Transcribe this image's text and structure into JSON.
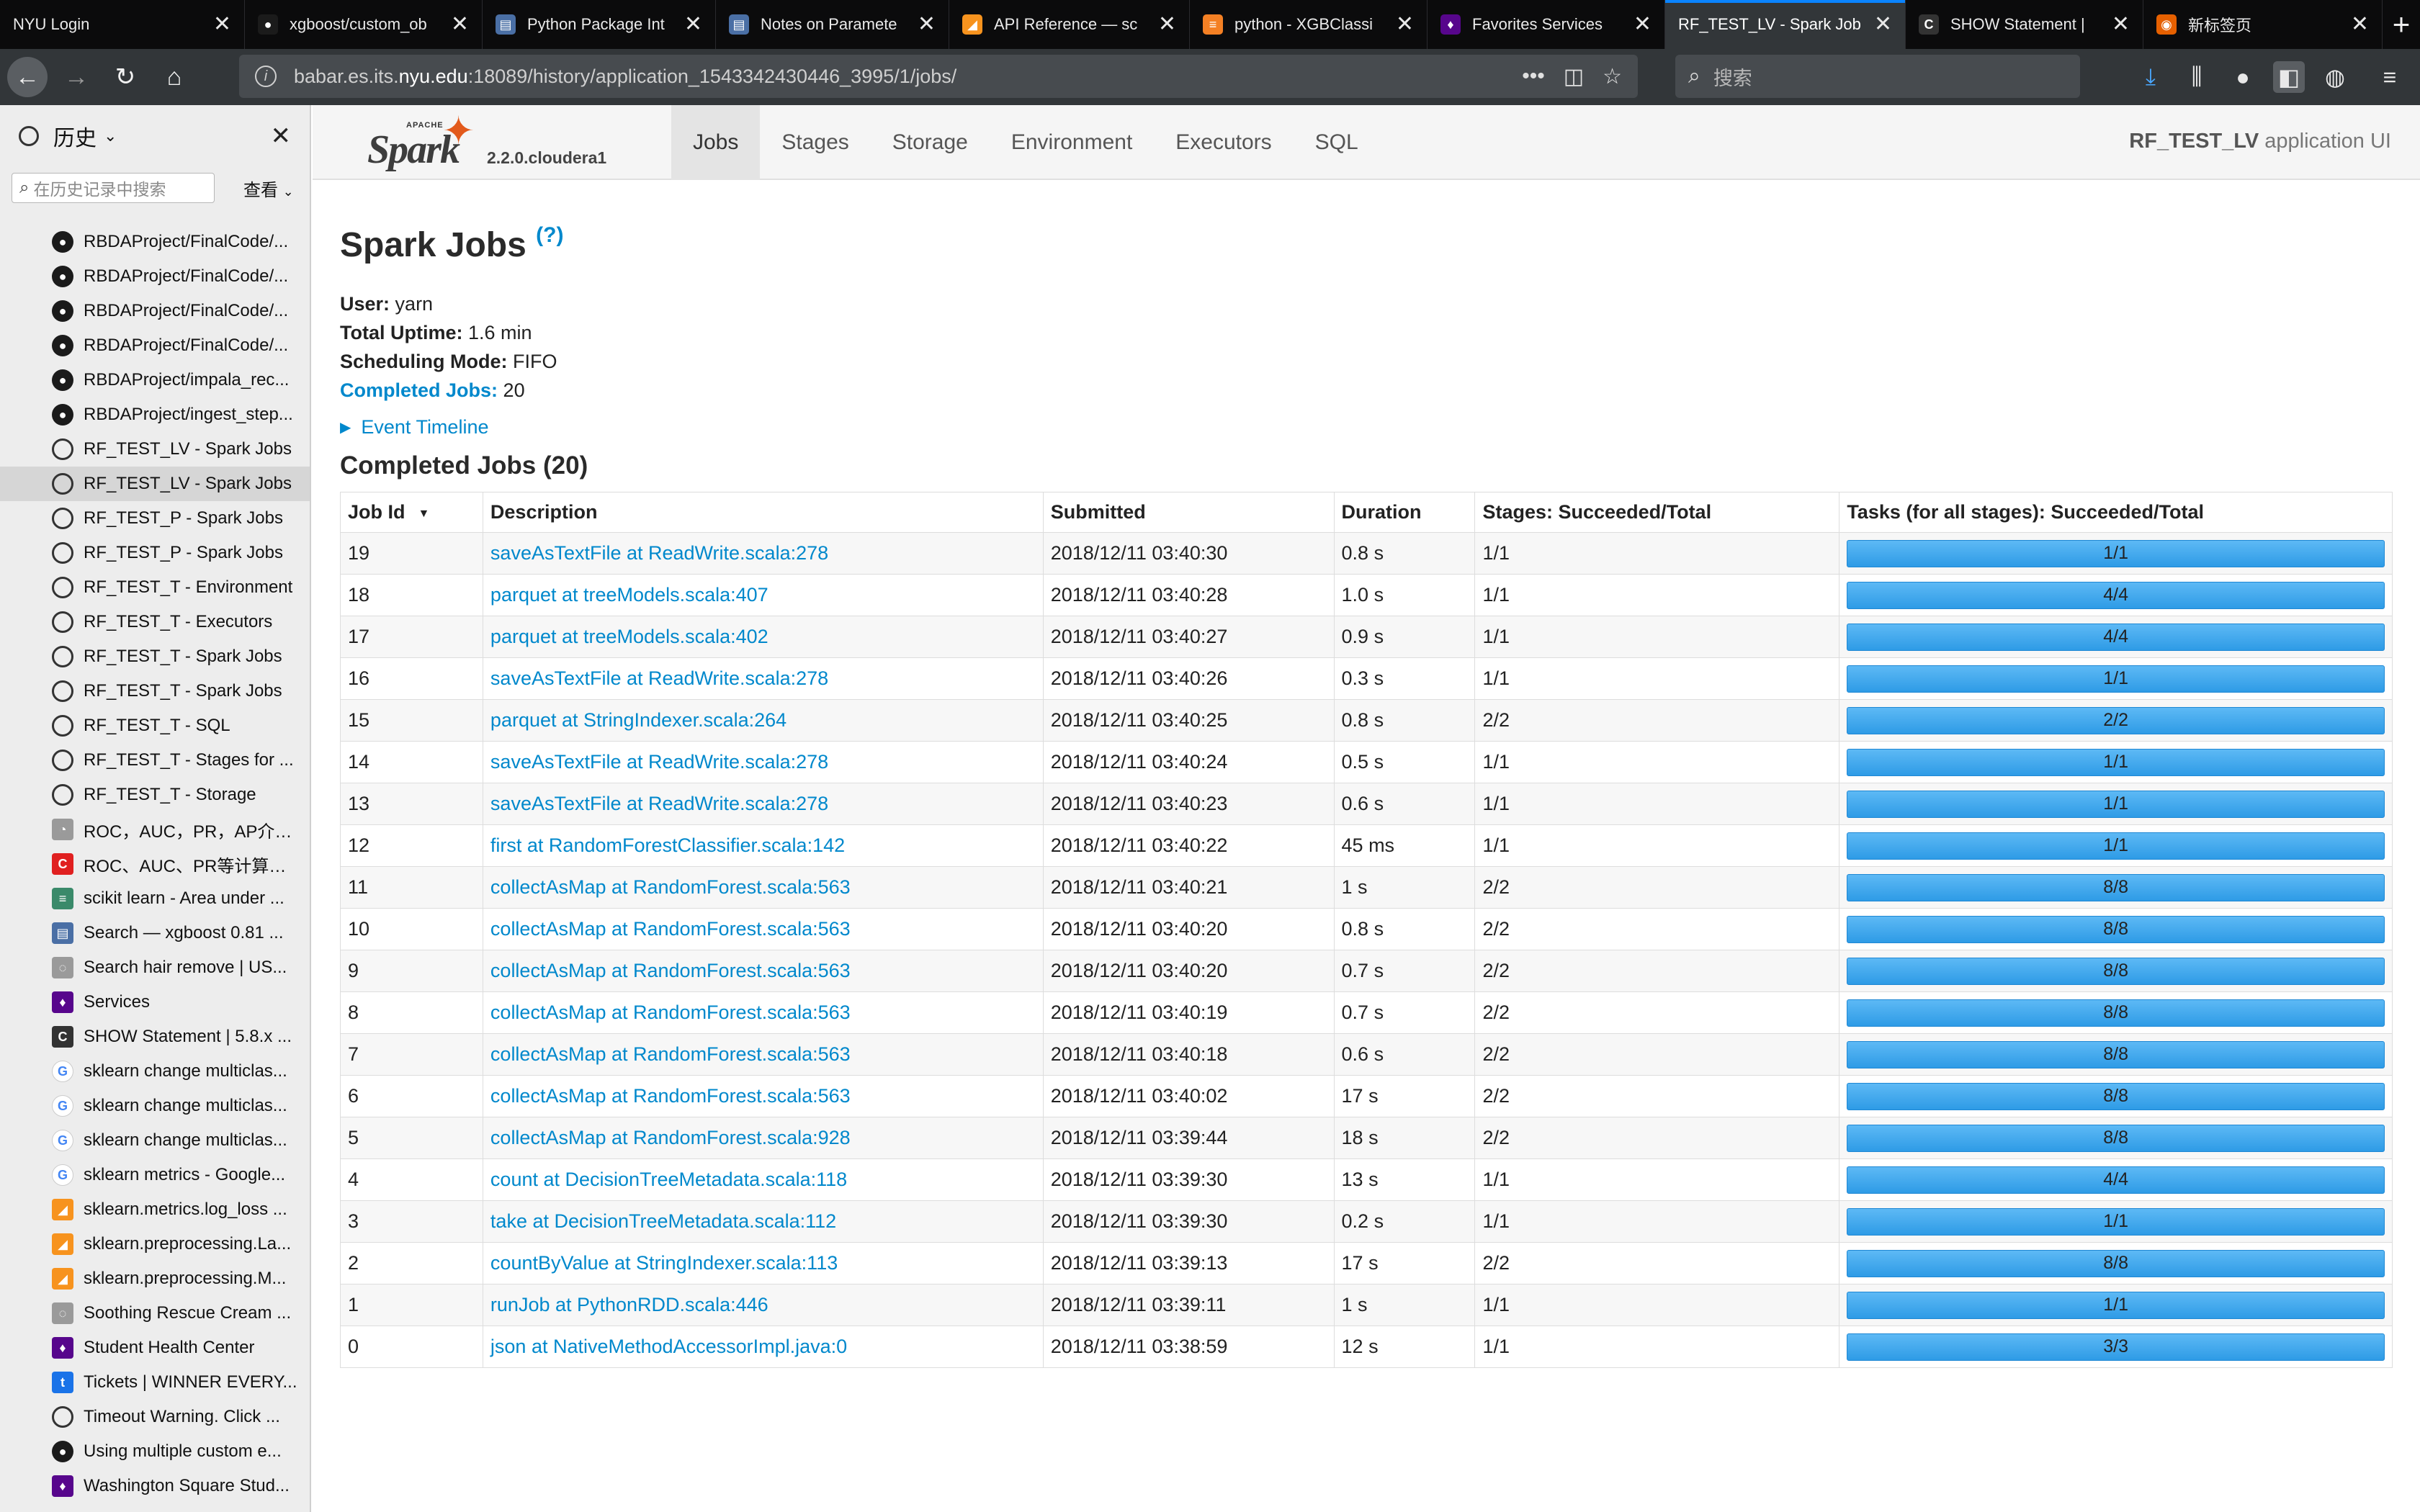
{
  "tabs": [
    {
      "label": "NYU Login",
      "icon": "none",
      "color": "#0b0b0c",
      "glyph": ""
    },
    {
      "label": "xgboost/custom_ob",
      "icon": "github-icon",
      "color": "#1b1b1b",
      "glyph": "●"
    },
    {
      "label": "Python Package Int",
      "icon": "docs-icon",
      "color": "#4a6fa5",
      "glyph": "▤"
    },
    {
      "label": "Notes on Paramete",
      "icon": "docs-icon",
      "color": "#4a6fa5",
      "glyph": "▤"
    },
    {
      "label": "API Reference — sc",
      "icon": "scikit-icon",
      "color": "#f7931e",
      "glyph": "◢"
    },
    {
      "label": "python - XGBClassi",
      "icon": "stackoverflow-icon",
      "color": "#f48024",
      "glyph": "≡"
    },
    {
      "label": "Favorites Services",
      "icon": "nyu-icon",
      "color": "#57068c",
      "glyph": "♦"
    },
    {
      "label": "RF_TEST_LV - Spark Job",
      "icon": "none",
      "color": "#323639",
      "glyph": ""
    },
    {
      "label": "SHOW Statement |",
      "icon": "cloudera-icon",
      "color": "#333333",
      "glyph": "C"
    },
    {
      "label": "新标签页",
      "icon": "firefox-icon",
      "color": "#e66000",
      "glyph": "◉"
    }
  ],
  "active_tab_index": 7,
  "url": {
    "prefix": "babar.es.its.",
    "domain": "nyu.edu",
    "rest": ":18089/history/application_1543342430446_3995/1/jobs/"
  },
  "search": {
    "placeholder": "搜索"
  },
  "sidebar": {
    "title": "历史",
    "search_placeholder": "在历史记录中搜索",
    "view_label": "查看",
    "items": [
      {
        "label": "RBDAProject/FinalCode/...",
        "icon": "github-icon",
        "color": "#1b1b1b",
        "glyph": "●"
      },
      {
        "label": "RBDAProject/FinalCode/...",
        "icon": "github-icon",
        "color": "#1b1b1b",
        "glyph": "●"
      },
      {
        "label": "RBDAProject/FinalCode/...",
        "icon": "github-icon",
        "color": "#1b1b1b",
        "glyph": "●"
      },
      {
        "label": "RBDAProject/FinalCode/...",
        "icon": "github-icon",
        "color": "#1b1b1b",
        "glyph": "●"
      },
      {
        "label": "RBDAProject/impala_rec...",
        "icon": "github-icon",
        "color": "#1b1b1b",
        "glyph": "●"
      },
      {
        "label": "RBDAProject/ingest_step...",
        "icon": "github-icon",
        "color": "#1b1b1b",
        "glyph": "●"
      },
      {
        "label": "RF_TEST_LV - Spark Jobs",
        "icon": "globe-icon",
        "color": "",
        "glyph": ""
      },
      {
        "label": "RF_TEST_LV - Spark Jobs",
        "icon": "globe-icon",
        "color": "",
        "glyph": ""
      },
      {
        "label": "RF_TEST_P - Spark Jobs",
        "icon": "globe-icon",
        "color": "",
        "glyph": ""
      },
      {
        "label": "RF_TEST_P - Spark Jobs",
        "icon": "globe-icon",
        "color": "",
        "glyph": ""
      },
      {
        "label": "RF_TEST_T - Environment",
        "icon": "globe-icon",
        "color": "",
        "glyph": ""
      },
      {
        "label": "RF_TEST_T - Executors",
        "icon": "globe-icon",
        "color": "",
        "glyph": ""
      },
      {
        "label": "RF_TEST_T - Spark Jobs",
        "icon": "globe-icon",
        "color": "",
        "glyph": ""
      },
      {
        "label": "RF_TEST_T - Spark Jobs",
        "icon": "globe-icon",
        "color": "",
        "glyph": ""
      },
      {
        "label": "RF_TEST_T - SQL",
        "icon": "globe-icon",
        "color": "",
        "glyph": ""
      },
      {
        "label": "RF_TEST_T - Stages for ...",
        "icon": "globe-icon",
        "color": "",
        "glyph": ""
      },
      {
        "label": "RF_TEST_T - Storage",
        "icon": "globe-icon",
        "color": "",
        "glyph": ""
      },
      {
        "label": "ROC，AUC，PR，AP介绍...",
        "icon": "chart-icon",
        "color": "#9a9a9a",
        "glyph": "◔"
      },
      {
        "label": "ROC、AUC、PR等计算方...",
        "icon": "csdn-icon",
        "color": "#e02020",
        "glyph": "C"
      },
      {
        "label": "scikit learn - Area under ...",
        "icon": "stackexchange-icon",
        "color": "#3a8a6a",
        "glyph": "≡"
      },
      {
        "label": "Search — xgboost 0.81 ...",
        "icon": "docs-icon",
        "color": "#4a6fa5",
        "glyph": "▤"
      },
      {
        "label": "Search hair remove | US...",
        "icon": "store-icon",
        "color": "#9a9a9a",
        "glyph": "◌"
      },
      {
        "label": "Services",
        "icon": "nyu-icon",
        "color": "#57068c",
        "glyph": "♦"
      },
      {
        "label": "SHOW Statement | 5.8.x ...",
        "icon": "cloudera-icon",
        "color": "#333333",
        "glyph": "C"
      },
      {
        "label": "sklearn change multiclas...",
        "icon": "google-icon",
        "color": "",
        "glyph": "G"
      },
      {
        "label": "sklearn change multiclas...",
        "icon": "google-icon",
        "color": "",
        "glyph": "G"
      },
      {
        "label": "sklearn change multiclas...",
        "icon": "google-icon",
        "color": "",
        "glyph": "G"
      },
      {
        "label": "sklearn metrics - Google...",
        "icon": "google-icon",
        "color": "",
        "glyph": "G"
      },
      {
        "label": "sklearn.metrics.log_loss ...",
        "icon": "scikit-icon",
        "color": "#f7931e",
        "glyph": "◢"
      },
      {
        "label": "sklearn.preprocessing.La...",
        "icon": "scikit-icon",
        "color": "#f7931e",
        "glyph": "◢"
      },
      {
        "label": "sklearn.preprocessing.M...",
        "icon": "scikit-icon",
        "color": "#f7931e",
        "glyph": "◢"
      },
      {
        "label": "Soothing Rescue Cream ...",
        "icon": "store-icon",
        "color": "#9a9a9a",
        "glyph": "◌"
      },
      {
        "label": "Student Health Center",
        "icon": "nyu-icon",
        "color": "#57068c",
        "glyph": "♦"
      },
      {
        "label": "Tickets | WINNER EVERY...",
        "icon": "ticket-icon",
        "color": "#1a73e8",
        "glyph": "t"
      },
      {
        "label": "Timeout Warning. Click ...",
        "icon": "globe-icon",
        "color": "",
        "glyph": ""
      },
      {
        "label": "Using multiple custom e...",
        "icon": "github-icon",
        "color": "#1b1b1b",
        "glyph": "●"
      },
      {
        "label": "Washington Square Stud...",
        "icon": "nyu-icon",
        "color": "#57068c",
        "glyph": "♦"
      }
    ],
    "selected_index": 7
  },
  "spark": {
    "logo_apache": "APACHE",
    "logo_word": "Spark",
    "version": "2.2.0.cloudera1",
    "nav": [
      "Jobs",
      "Stages",
      "Storage",
      "Environment",
      "Executors",
      "SQL"
    ],
    "active_nav": 0,
    "app_name": "RF_TEST_LV",
    "app_suffix": " application UI"
  },
  "page": {
    "title": "Spark Jobs",
    "help": "(?)",
    "user_label": "User:",
    "user": "yarn",
    "uptime_label": "Total Uptime:",
    "uptime": "1.6 min",
    "mode_label": "Scheduling Mode:",
    "mode": "FIFO",
    "completed_label": "Completed Jobs:",
    "completed": "20",
    "event_timeline": "Event Timeline",
    "section_title": "Completed Jobs (20)"
  },
  "table": {
    "headers": [
      "Job Id",
      "Description",
      "Submitted",
      "Duration",
      "Stages: Succeeded/Total",
      "Tasks (for all stages): Succeeded/Total"
    ],
    "rows": [
      {
        "id": "19",
        "desc": "saveAsTextFile at ReadWrite.scala:278",
        "submitted": "2018/12/11 03:40:30",
        "duration": "0.8 s",
        "stages": "1/1",
        "tasks": "1/1"
      },
      {
        "id": "18",
        "desc": "parquet at treeModels.scala:407",
        "submitted": "2018/12/11 03:40:28",
        "duration": "1.0 s",
        "stages": "1/1",
        "tasks": "4/4"
      },
      {
        "id": "17",
        "desc": "parquet at treeModels.scala:402",
        "submitted": "2018/12/11 03:40:27",
        "duration": "0.9 s",
        "stages": "1/1",
        "tasks": "4/4"
      },
      {
        "id": "16",
        "desc": "saveAsTextFile at ReadWrite.scala:278",
        "submitted": "2018/12/11 03:40:26",
        "duration": "0.3 s",
        "stages": "1/1",
        "tasks": "1/1"
      },
      {
        "id": "15",
        "desc": "parquet at StringIndexer.scala:264",
        "submitted": "2018/12/11 03:40:25",
        "duration": "0.8 s",
        "stages": "2/2",
        "tasks": "2/2"
      },
      {
        "id": "14",
        "desc": "saveAsTextFile at ReadWrite.scala:278",
        "submitted": "2018/12/11 03:40:24",
        "duration": "0.5 s",
        "stages": "1/1",
        "tasks": "1/1"
      },
      {
        "id": "13",
        "desc": "saveAsTextFile at ReadWrite.scala:278",
        "submitted": "2018/12/11 03:40:23",
        "duration": "0.6 s",
        "stages": "1/1",
        "tasks": "1/1"
      },
      {
        "id": "12",
        "desc": "first at RandomForestClassifier.scala:142",
        "submitted": "2018/12/11 03:40:22",
        "duration": "45 ms",
        "stages": "1/1",
        "tasks": "1/1"
      },
      {
        "id": "11",
        "desc": "collectAsMap at RandomForest.scala:563",
        "submitted": "2018/12/11 03:40:21",
        "duration": "1 s",
        "stages": "2/2",
        "tasks": "8/8"
      },
      {
        "id": "10",
        "desc": "collectAsMap at RandomForest.scala:563",
        "submitted": "2018/12/11 03:40:20",
        "duration": "0.8 s",
        "stages": "2/2",
        "tasks": "8/8"
      },
      {
        "id": "9",
        "desc": "collectAsMap at RandomForest.scala:563",
        "submitted": "2018/12/11 03:40:20",
        "duration": "0.7 s",
        "stages": "2/2",
        "tasks": "8/8"
      },
      {
        "id": "8",
        "desc": "collectAsMap at RandomForest.scala:563",
        "submitted": "2018/12/11 03:40:19",
        "duration": "0.7 s",
        "stages": "2/2",
        "tasks": "8/8"
      },
      {
        "id": "7",
        "desc": "collectAsMap at RandomForest.scala:563",
        "submitted": "2018/12/11 03:40:18",
        "duration": "0.6 s",
        "stages": "2/2",
        "tasks": "8/8"
      },
      {
        "id": "6",
        "desc": "collectAsMap at RandomForest.scala:563",
        "submitted": "2018/12/11 03:40:02",
        "duration": "17 s",
        "stages": "2/2",
        "tasks": "8/8"
      },
      {
        "id": "5",
        "desc": "collectAsMap at RandomForest.scala:928",
        "submitted": "2018/12/11 03:39:44",
        "duration": "18 s",
        "stages": "2/2",
        "tasks": "8/8"
      },
      {
        "id": "4",
        "desc": "count at DecisionTreeMetadata.scala:118",
        "submitted": "2018/12/11 03:39:30",
        "duration": "13 s",
        "stages": "1/1",
        "tasks": "4/4"
      },
      {
        "id": "3",
        "desc": "take at DecisionTreeMetadata.scala:112",
        "submitted": "2018/12/11 03:39:30",
        "duration": "0.2 s",
        "stages": "1/1",
        "tasks": "1/1"
      },
      {
        "id": "2",
        "desc": "countByValue at StringIndexer.scala:113",
        "submitted": "2018/12/11 03:39:13",
        "duration": "17 s",
        "stages": "2/2",
        "tasks": "8/8"
      },
      {
        "id": "1",
        "desc": "runJob at PythonRDD.scala:446",
        "submitted": "2018/12/11 03:39:11",
        "duration": "1 s",
        "stages": "1/1",
        "tasks": "1/1"
      },
      {
        "id": "0",
        "desc": "json at NativeMethodAccessorImpl.java:0",
        "submitted": "2018/12/11 03:38:59",
        "duration": "12 s",
        "stages": "1/1",
        "tasks": "3/3"
      }
    ]
  }
}
